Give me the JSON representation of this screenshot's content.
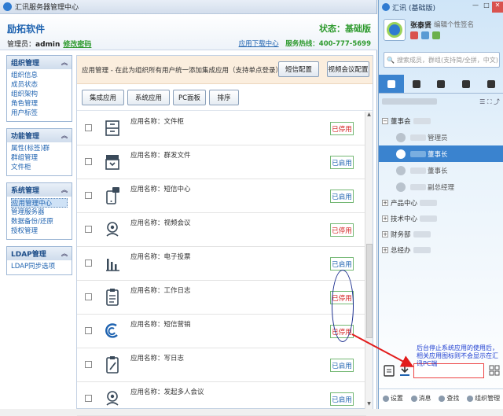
{
  "admin_window": {
    "title": "汇讯服务器管理中心",
    "company": "励拓软件",
    "status": "状态：基础版",
    "admin_label": "管理员：",
    "admin_name": "admin",
    "change_password": "修改密码",
    "download_center": "应用下载中心",
    "hotline": "服务热线：400-777-5699"
  },
  "sidebar": [
    {
      "title": "组织管理",
      "items": [
        "组织信息",
        "成员状态",
        "组织架构",
        "角色管理",
        "用户标签"
      ]
    },
    {
      "title": "功能管理",
      "items": [
        "属性(标签)群",
        "群组管理",
        "文件柜"
      ]
    },
    {
      "title": "系统管理",
      "items": [
        "应用管理中心",
        "管理服务器",
        "数据备份/还原",
        "授权管理"
      ]
    },
    {
      "title": "LDAP管理",
      "items": [
        "LDAP同步选项"
      ]
    }
  ],
  "main": {
    "info_text": "应用管理 - 在此为组织所有用户统一添加集成应用（支持单点登录）",
    "sms_config": "短信配置",
    "video_config": "视频会议配置",
    "tabs": [
      "集成应用",
      "系统应用",
      "PC面板",
      "排序"
    ],
    "apps": [
      {
        "name": "应用名称：文件柜",
        "status": "已停用",
        "enabled": false,
        "icon": "file-cabinet-icon"
      },
      {
        "name": "应用名称：群发文件",
        "status": "已启用",
        "enabled": true,
        "icon": "inbox-icon"
      },
      {
        "name": "应用名称：短信中心",
        "status": "已启用",
        "enabled": true,
        "icon": "phone-message-icon"
      },
      {
        "name": "应用名称：视频会议",
        "status": "已停用",
        "enabled": false,
        "icon": "video-meeting-icon"
      },
      {
        "name": "应用名称：电子投票",
        "status": "已启用",
        "enabled": true,
        "icon": "bar-chart-icon"
      },
      {
        "name": "应用名称：工作日志",
        "status": "已停用",
        "enabled": false,
        "icon": "clipboard-icon"
      },
      {
        "name": "应用名称：短信营销",
        "status": "已停用",
        "enabled": false,
        "icon": "sms-marketing-icon"
      },
      {
        "name": "应用名称：写日志",
        "status": "已启用",
        "enabled": true,
        "icon": "write-log-icon"
      },
      {
        "name": "应用名称：发起多人会议",
        "status": "已启用",
        "enabled": true,
        "icon": "multi-meeting-icon"
      }
    ]
  },
  "client": {
    "title": "汇讯",
    "subtitle": "(基础版)",
    "user_name": "张泰贤",
    "signature": "编辑个性签名",
    "search_placeholder": "搜索成员，群组(支持简/全拼，中文)",
    "tree": {
      "group": "董事会",
      "members": [
        {
          "title": "管理员",
          "selected": false
        },
        {
          "title": "董事长",
          "selected": true
        },
        {
          "title": "董事长",
          "selected": false
        },
        {
          "title": "副总经理",
          "selected": false
        }
      ],
      "departments": [
        "产品中心",
        "技术中心",
        "财务部",
        "总经办"
      ]
    },
    "bottom": [
      "设置",
      "消息",
      "查找",
      "组织管理"
    ]
  },
  "annotation": "后台停止系统应用的使用后，相关应用图标则不会显示在汇讯PC端",
  "colors": {
    "accent": "#1f63b0",
    "enabled_status": "#1f63b0",
    "disabled_status": "#d21f1f",
    "status_green": "#2e9a2e"
  }
}
